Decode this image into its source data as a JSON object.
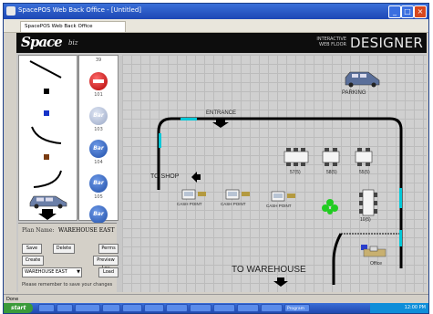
{
  "window": {
    "title": "SpacePOS Web Back Office - [Untitled]",
    "tab": "SpacePOS Web Back Office",
    "controls": [
      "_",
      "□",
      "×"
    ]
  },
  "header": {
    "logo": "Space",
    "logo_suffix": "biz",
    "subtitle": "INTERACTIVE WEB FLOOR",
    "title": "DESIGNER"
  },
  "icon_palette": {
    "top_number": "39",
    "items": [
      {
        "label": "",
        "number": "101"
      },
      {
        "label": "Bar",
        "number": "103"
      },
      {
        "label": "Bar",
        "number": "104"
      },
      {
        "label": "Bar",
        "number": "105"
      },
      {
        "label": "Bar",
        "number": ""
      }
    ]
  },
  "form": {
    "plan_name_label": "Plan Name:",
    "plan_name_value": "WAREHOUSE EAST",
    "buttons": {
      "save": "Save",
      "delete": "Delete",
      "perms": "Perms",
      "create": "Create",
      "preview": "Preview Lay",
      "load": "Load"
    },
    "select_value": "WAREHOUSE EAST",
    "hint": "Please remember to save your changes"
  },
  "canvas": {
    "labels": {
      "entrance": "ENTRANCE",
      "parking": "PARKING",
      "to_shop": "TO SHOP",
      "to_warehouse": "TO WAREHOUSE",
      "office": "Office"
    },
    "tables": [
      "57(5)",
      "58(5)",
      "55(5)",
      "10(5)"
    ],
    "cash_points": [
      "CASH POINT",
      "CASH POINT",
      "CASH POINT"
    ]
  },
  "statusbar": {
    "text": "Done"
  },
  "taskbar": {
    "start": "start",
    "clock": "12:00 PM",
    "tasks": [
      "",
      "",
      "",
      "",
      "",
      "",
      "",
      "",
      "",
      "",
      "",
      "Program"
    ]
  },
  "colors": {
    "wall": "#000000",
    "door": "#00c8d8",
    "plant": "#22cc22",
    "bar_icon": "#2f62c0",
    "red_icon": "#d11010",
    "header_bg": "#0d0d0d"
  }
}
